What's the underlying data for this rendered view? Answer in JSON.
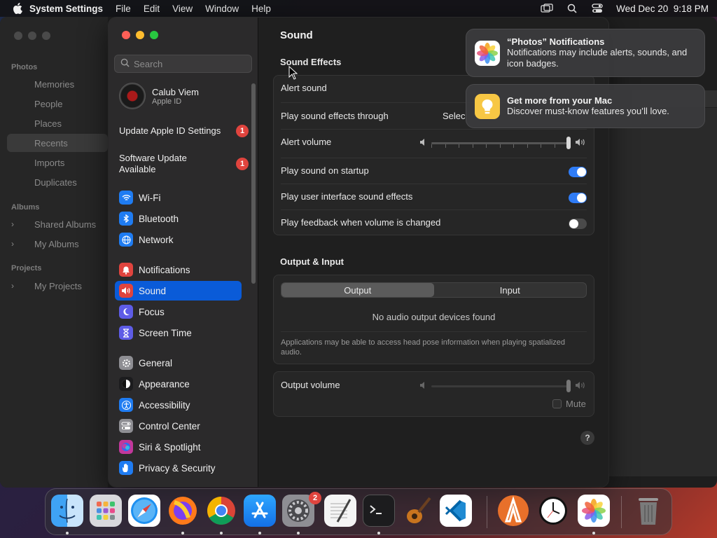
{
  "menubar": {
    "app_name": "System Settings",
    "items": [
      "File",
      "Edit",
      "View",
      "Window",
      "Help"
    ],
    "datetime": "Wed Dec 20  9:18 PM"
  },
  "photos_window": {
    "sections": {
      "photos": "Photos",
      "albums": "Albums",
      "projects": "Projects"
    },
    "items": [
      "Memories",
      "People",
      "Places",
      "Recents",
      "Imports",
      "Duplicates"
    ],
    "albums": [
      "Shared Albums",
      "My Albums"
    ],
    "projects": [
      "My Projects"
    ],
    "selected": "Recents"
  },
  "settings": {
    "search_placeholder": "Search",
    "profile": {
      "name": "Calub Viem",
      "sub": "Apple ID"
    },
    "notices": [
      {
        "label": "Update Apple ID Settings",
        "badge": "1"
      },
      {
        "label": "Software Update Available",
        "badge": "1"
      }
    ],
    "nav": [
      {
        "label": "Wi-Fi",
        "icon": "wifi-icon",
        "color": "#1f7cf2"
      },
      {
        "label": "Bluetooth",
        "icon": "bluetooth-icon",
        "color": "#1f7cf2"
      },
      {
        "label": "Network",
        "icon": "globe-icon",
        "color": "#1f7cf2"
      },
      {
        "label": "Notifications",
        "icon": "bell-icon",
        "color": "#e0443e"
      },
      {
        "label": "Sound",
        "icon": "speaker-icon",
        "color": "#e0443e"
      },
      {
        "label": "Focus",
        "icon": "moon-icon",
        "color": "#5e5ce6"
      },
      {
        "label": "Screen Time",
        "icon": "hourglass-icon",
        "color": "#5e5ce6"
      },
      {
        "label": "General",
        "icon": "gear-icon",
        "color": "#8e8e93"
      },
      {
        "label": "Appearance",
        "icon": "appearance-icon",
        "color": "#1c1c1e"
      },
      {
        "label": "Accessibility",
        "icon": "accessibility-icon",
        "color": "#1f7cf2"
      },
      {
        "label": "Control Center",
        "icon": "control-center-icon",
        "color": "#8e8e93"
      },
      {
        "label": "Siri & Spotlight",
        "icon": "siri-icon",
        "color": "#c2389b"
      },
      {
        "label": "Privacy & Security",
        "icon": "hand-icon",
        "color": "#1f7cf2"
      }
    ],
    "selected_nav": "Sound",
    "accent": "#0a5bd8"
  },
  "sound": {
    "title": "Sound",
    "effects_head": "Sound Effects",
    "alert_sound": "Alert sound",
    "play_through": "Play sound effects through",
    "play_through_value": "Selec",
    "alert_volume": "Alert volume",
    "alert_volume_level": 1.0,
    "startup": {
      "label": "Play sound on startup",
      "on": true
    },
    "ui_effects": {
      "label": "Play user interface sound effects",
      "on": true
    },
    "feedback": {
      "label": "Play feedback when volume is changed",
      "on": false
    },
    "output_head": "Output & Input",
    "tabs": [
      "Output",
      "Input"
    ],
    "active_tab": "Output",
    "no_devices": "No audio output devices found",
    "head_pose_note": "Applications may be able to access head pose information when playing spatialized audio.",
    "output_volume": "Output volume",
    "output_volume_level": 1.0,
    "mute_label": "Mute",
    "help": "?"
  },
  "notifications": [
    {
      "title": "“Photos” Notifications",
      "body": "Notifications may include alerts, sounds, and icon badges.",
      "icon": "photos-icon"
    },
    {
      "title": "Get more from your Mac",
      "body": "Discover must-know features you’ll love.",
      "icon": "tips-icon"
    }
  ],
  "dock": {
    "apps": [
      "Finder",
      "Launchpad",
      "Safari",
      "Firefox",
      "Chrome",
      "App Store",
      "System Settings",
      "TextEdit",
      "Terminal",
      "GarageBand",
      "VS Code",
      "Osmium",
      "Clock",
      "Photos",
      "Trash"
    ],
    "settings_badge": "2"
  }
}
